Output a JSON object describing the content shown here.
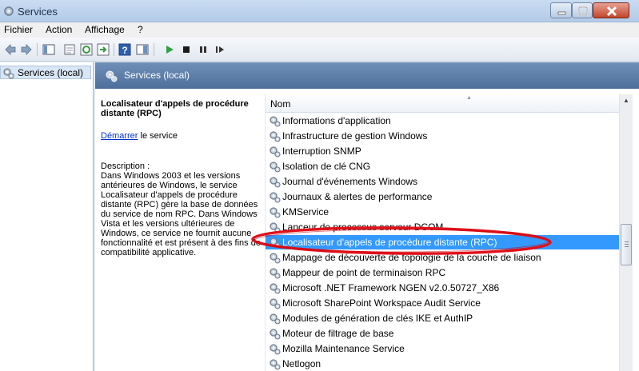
{
  "window": {
    "title": "Services"
  },
  "menu": [
    "Fichier",
    "Action",
    "Affichage",
    "?"
  ],
  "tree": {
    "root_label": "Services (local)"
  },
  "header": {
    "title": "Services (local)"
  },
  "details": {
    "service_name": "Localisateur d'appels de procédure distante (RPC)",
    "start_link": "Démarrer",
    "start_suffix": " le service",
    "description_title": "Description :",
    "description_text": "Dans Windows 2003 et les versions antérieures de Windows, le service Localisateur d'appels de procédure distante (RPC) gère la base de données du service de nom RPC. Dans Windows Vista et les versions ultérieures de Windows, ce service ne fournit aucune fonctionnalité et est présent à des fins de compatibilité applicative."
  },
  "list": {
    "column_name": "Nom",
    "rows": [
      "Informations d'application",
      "Infrastructure de gestion Windows",
      "Interruption SNMP",
      "Isolation de clé CNG",
      "Journal d'événements Windows",
      "Journaux & alertes de performance",
      "KMService",
      "Lanceur de processus serveur DCOM",
      "Localisateur d'appels de procédure distante (RPC)",
      "Mappage de découverte de topologie de la couche de liaison",
      "Mappeur de point de terminaison RPC",
      "Microsoft .NET Framework NGEN v2.0.50727_X86",
      "Microsoft SharePoint Workspace Audit Service",
      "Modules de génération de clés IKE et AuthIP",
      "Moteur de filtrage de base",
      "Mozilla Maintenance Service",
      "Netlogon"
    ],
    "selected_index": 8
  },
  "colors": {
    "selection": "#3399ff",
    "header": "#5a7aa5",
    "highlight_circle": "#e0101a"
  }
}
